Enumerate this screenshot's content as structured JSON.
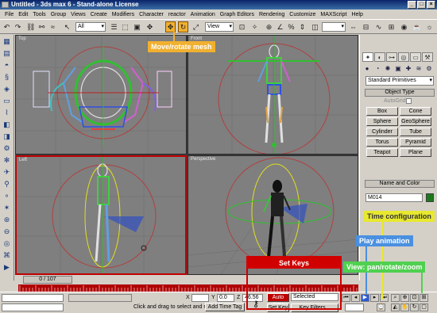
{
  "window": {
    "title": "Untitled - 3ds max 6 - Stand-alone License",
    "controls": [
      "_",
      "□",
      "×"
    ]
  },
  "menubar": {
    "items": [
      "File",
      "Edit",
      "Tools",
      "Group",
      "Views",
      "Create",
      "Modifiers",
      "Character",
      "reactor",
      "Animation",
      "Graph Editors",
      "Rendering",
      "Customize",
      "MAXScript",
      "Help"
    ]
  },
  "toolbar": {
    "selection_filter": "All",
    "ref_coord": "View"
  },
  "viewports": {
    "top": "Top",
    "front": "Front",
    "left": "Left",
    "perspective": "Perspective"
  },
  "command_panel": {
    "dropdown": "Standard Primitives",
    "object_type_header": "Object Type",
    "autogrid_label": "AutoGrid",
    "buttons": [
      "Box",
      "Cone",
      "Sphere",
      "GeoSphere",
      "Cylinder",
      "Tube",
      "Torus",
      "Pyramid",
      "Teapot",
      "Plane"
    ],
    "name_color_header": "Name and Color",
    "object_name": "M014",
    "object_color": "#1c7a1c"
  },
  "timeline": {
    "frame_label": "0 / 107"
  },
  "status": {
    "x_label": "X",
    "x_value": "",
    "y_label": "Y",
    "y_value": "0.0",
    "z_label": "Z",
    "z_value": "46.56",
    "prompt": "Click and drag to select and rotate",
    "add_time_tag": "Add Time Tag",
    "auto_key": "Auto Key",
    "key_mode": "Selected",
    "set_key": "Set Key",
    "key_filters": "Key Filters..."
  },
  "annotations": {
    "move_rotate": {
      "text": "Move/rotate mesh",
      "color": "#f0b030"
    },
    "set_keys": {
      "text": "Set Keys",
      "color": "#d00000"
    },
    "time_config": {
      "text": "Time configuration",
      "color": "#e8e830"
    },
    "play_animation": {
      "text": "Play animation",
      "color": "#4a90e0"
    },
    "view_controls": {
      "text": "View: pan/rotate/zoom",
      "color": "#50d050"
    }
  }
}
